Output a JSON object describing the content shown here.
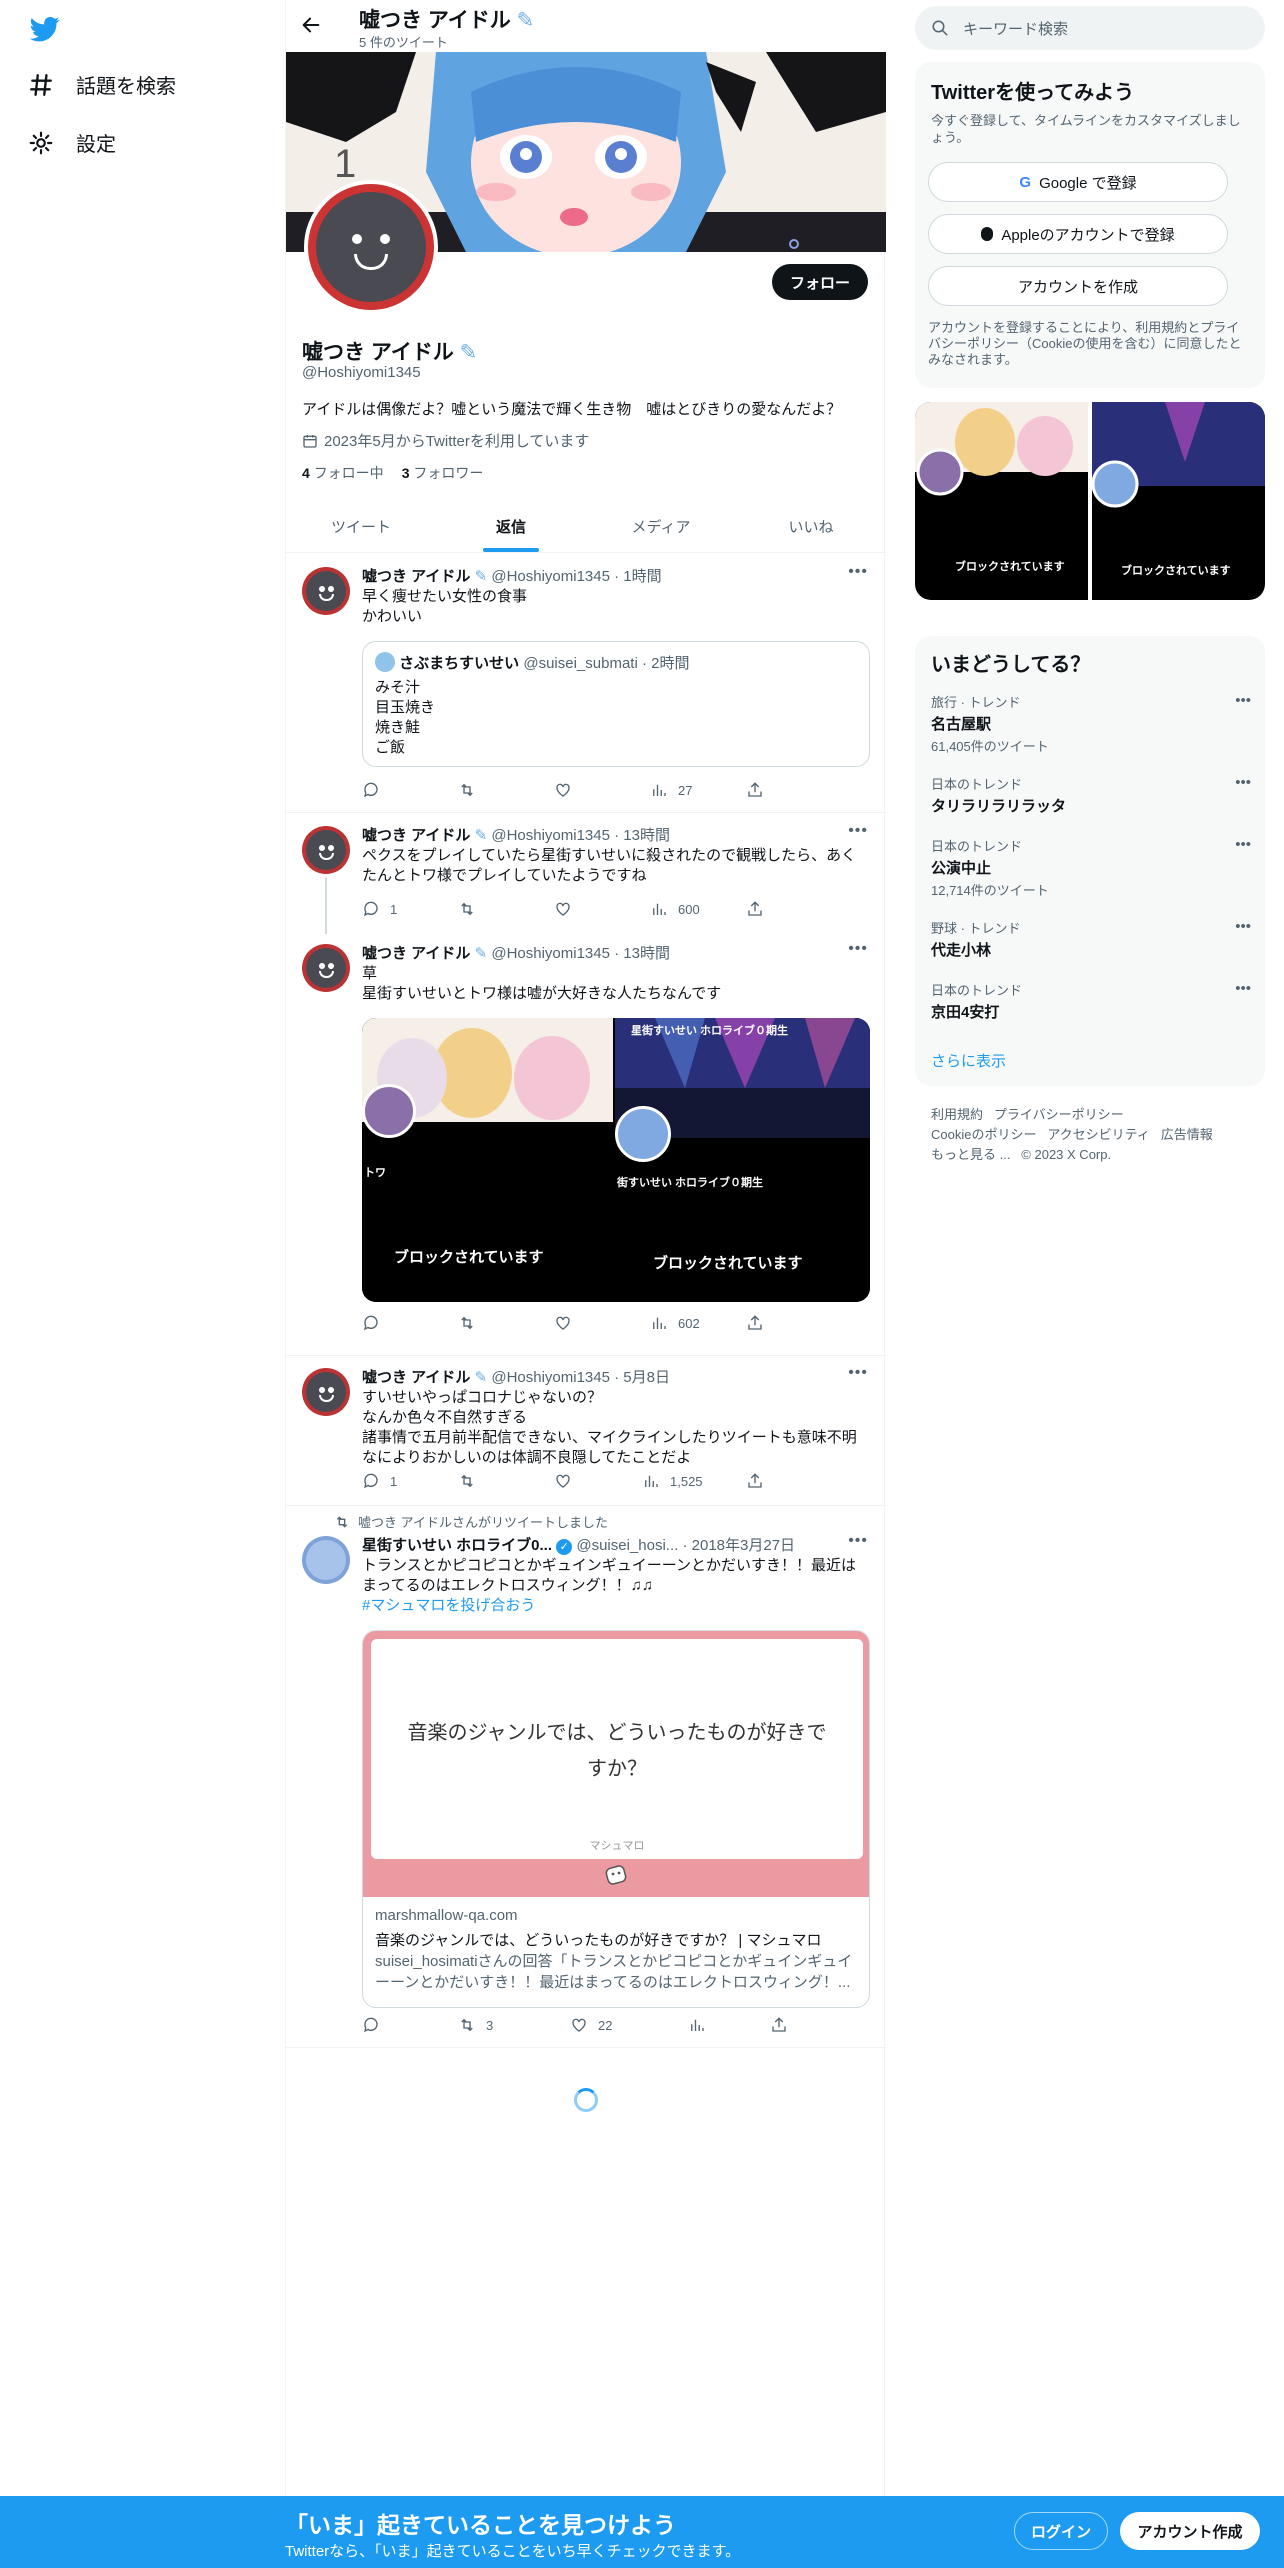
{
  "nav": {
    "explore_label": "話題を検索",
    "settings_label": "設定"
  },
  "profile": {
    "name": "嘘つき アイドル",
    "tweet_count": "5 件のツイート",
    "follow_label": "フォロー",
    "handle": "@Hoshiyomi1345",
    "bio": "アイドルは偶像だよ？嘘という魔法で輝く生き物　嘘はとびきりの愛なんだよ？",
    "joined": "2023年5月からTwitterを利用しています",
    "following_count": "4",
    "following_label": "フォロー中",
    "followers_count": "3",
    "followers_label": "フォロワー"
  },
  "tabs": [
    "ツイート",
    "返信",
    "メディア",
    "いいね"
  ],
  "tweets": [
    {
      "name": "嘘つき アイドル",
      "handle": "@Hoshiyomi1345",
      "time": "· 1時間",
      "lines": [
        "早く痩せたい女性の食事",
        "かわいい"
      ],
      "quote": {
        "name": "さぶまちすいせい",
        "handle": "@suisei_submati",
        "time": "· 2時間",
        "lines": [
          "みそ汁",
          "目玉焼き",
          "焼き鮭",
          "ご飯"
        ]
      },
      "views": "27"
    },
    {
      "name": "嘘つき アイドル",
      "handle": "@Hoshiyomi1345",
      "time": "· 13時間",
      "lines": [
        "ペクスをプレイしていたら星街すいせいに殺されたので観戦したら、あく",
        "たんとトワ様でプレイしていたようですね"
      ],
      "replies": "1",
      "views": "600"
    },
    {
      "name": "嘘つき アイドル",
      "handle": "@Hoshiyomi1345",
      "time": "· 13時間",
      "lines": [
        "草",
        "星街すいせいとトワ様は嘘が大好きな人たちなんです"
      ],
      "media_left_label": "トワ",
      "media_right_label": "星街すいせい ホロライブ０期生",
      "media_right_bottom_label": "街すいせい ホロライブ０期生",
      "blocked_label": "ブロックされています",
      "views": "602"
    },
    {
      "name": "嘘つき アイドル",
      "handle": "@Hoshiyomi1345",
      "time": "· 5月8日",
      "lines": [
        "すいせいやっぱコロナじゃないの？",
        "なんか色々不自然すぎる",
        "諸事情で五月前半配信できない、マイクラインしたりツイートも意味不明",
        "なによりおかしいのは体調不良隠してたことだよ"
      ],
      "replies": "1",
      "views": "1,525"
    },
    {
      "retweet_note": "嘘つき アイドルさんがリツイートしました",
      "name": "星街すいせい ホロライブ0...",
      "handle": "@suisei_hosi...",
      "time": "· 2018年3月27日",
      "lines": [
        "トランスとかピコピコとかギュインギュイーーンとかだいすき！！最近は",
        "まってるのはエレクトロスウィング！！♫♫"
      ],
      "hashtag": "#マシュマロを投げ合おう",
      "card": {
        "question": "音楽のジャンルでは、どういったものが好きですか？",
        "brand": "マシュマロ",
        "domain": "marshmallow-qa.com",
        "title": "音楽のジャンルでは、どういったものが好きですか？ | マシュマロ",
        "desc": "suisei_hosimatiさんの回答「トランスとかピコピコとかギュインギュイーーンとかだいすき！！最近はまってるのはエレクトロスウィング！..."
      },
      "retweets": "3",
      "likes": "22"
    }
  ],
  "right": {
    "search_placeholder": "キーワード検索",
    "signup_title": "Twitterを使ってみよう",
    "signup_desc": "今すぐ登録して、タイムラインをカスタマイズしましょう。",
    "google_label": "Google で登録",
    "apple_label": "Appleのアカウントで登録",
    "create_label": "アカウントを作成",
    "terms_text": "アカウントを登録することにより、利用規約とプライバシーポリシー（Cookieの使用を含む）に同意したとみなされます。",
    "media_blocked": "ブロックされています",
    "trends_title": "いまどうしてる？",
    "trends": [
      {
        "cat": "旅行 · トレンド",
        "name": "名古屋駅",
        "cnt": "61,405件のツイート"
      },
      {
        "cat": "日本のトレンド",
        "name": "タリラリラリラッタ",
        "cnt": ""
      },
      {
        "cat": "日本のトレンド",
        "name": "公演中止",
        "cnt": "12,714件のツイート"
      },
      {
        "cat": "野球 · トレンド",
        "name": "代走小林",
        "cnt": ""
      },
      {
        "cat": "日本のトレンド",
        "name": "京田4安打",
        "cnt": ""
      }
    ],
    "show_more": "さらに表示",
    "footer": [
      "利用規約",
      "プライバシーポリシー",
      "Cookieのポリシー",
      "アクセシビリティ",
      "広告情報",
      "もっと見る ...",
      "© 2023 X Corp."
    ]
  },
  "bottom": {
    "title": "「いま」起きていることを見つけよう",
    "subtitle": "Twitterなら、「いま」起きていることをいち早くチェックできます。",
    "login_label": "ログイン",
    "signup_label": "アカウント作成"
  },
  "colors": {
    "accent": "#1d9bf0",
    "text": "#0f1419",
    "muted": "#536471"
  }
}
